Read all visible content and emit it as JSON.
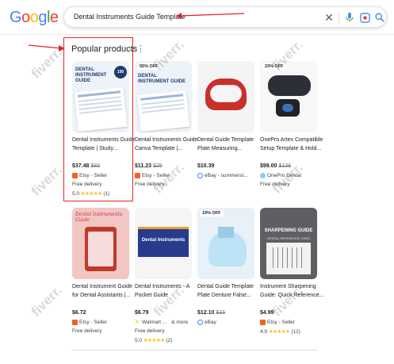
{
  "header": {
    "logo": "Google",
    "search_query": "Dental Instruments Guide Template"
  },
  "section": {
    "title": "Popular products"
  },
  "products": [
    {
      "badge": "",
      "thumb_title": "DENTAL INSTRUMENT GUIDE",
      "thumb_count": "190",
      "title": "Dental Instruments Guide Template | Study...",
      "price": "$37.48",
      "old_price": "$83",
      "seller": "Etsy - Seller",
      "delivery": "Free delivery",
      "rating": "5.0",
      "stars": "★★★★★",
      "reviews": "(1)",
      "seller_icon": "etsy-icon"
    },
    {
      "badge": "55% OFF",
      "thumb_title": "DENTAL INSTRUMENT GUIDE",
      "thumb_count": "",
      "title": "Dental Instruments Guide Canva Template |...",
      "price": "$11.23",
      "old_price": "$25",
      "seller": "Etsy - Seller",
      "delivery": "Free delivery",
      "rating": "",
      "stars": "",
      "reviews": "",
      "seller_icon": "etsy-icon"
    },
    {
      "badge": "",
      "thumb_title": "",
      "thumb_count": "",
      "title": "Dental Guide Template Plate Measuring...",
      "price": "$10.39",
      "old_price": "",
      "seller": "eBay - summerst...",
      "delivery": "",
      "rating": "",
      "stars": "",
      "reviews": "",
      "seller_icon": "ebay-icon"
    },
    {
      "badge": "23% OFF",
      "thumb_title": "",
      "thumb_count": "",
      "title": "OnePro Artex Compatible Setup Template & Hold...",
      "price": "$99.00",
      "old_price": "$129",
      "seller": "OnePro Dental",
      "delivery": "Free delivery",
      "rating": "",
      "stars": "",
      "reviews": "",
      "seller_icon": "onepro-icon"
    },
    {
      "badge": "",
      "thumb_title": "Dental Instruments Guide",
      "thumb_count": "",
      "title": "Dental Instrument Guide for Dental Assistants |...",
      "price": "$6.72",
      "old_price": "",
      "seller": "Etsy - Seller",
      "delivery": "Free delivery",
      "rating": "",
      "stars": "",
      "reviews": "",
      "seller_icon": "etsy-icon"
    },
    {
      "badge": "",
      "thumb_title": "Dental Instruments",
      "thumb_count": "",
      "title": "Dental Instruments - A Pocket Guide",
      "price": "$6.79",
      "old_price": "",
      "seller": "Walmart ...",
      "seller_more": "& more",
      "delivery": "Free delivery",
      "rating": "5.0",
      "stars": "★★★★★",
      "reviews": "(2)",
      "seller_icon": "walmart-icon"
    },
    {
      "badge": "19% OFF",
      "thumb_title": "",
      "thumb_count": "",
      "title": "Dental Guide Template Plate Denture False...",
      "price": "$12.10",
      "old_price": "$15",
      "seller": "eBay",
      "delivery": "",
      "rating": "",
      "stars": "",
      "reviews": "",
      "seller_icon": "ebay-icon"
    },
    {
      "badge": "",
      "thumb_title": "SHARPENING GUIDE",
      "thumb_subtitle": "DENTAL REFERENCE CARD",
      "thumb_count": "",
      "title": "Instrument Sharpening Guide: Quick Reference...",
      "price": "$4.99",
      "old_price": "",
      "seller": "Etsy - Seller",
      "delivery": "",
      "rating": "4.9",
      "stars": "★★★★★",
      "reviews": "(12)",
      "seller_icon": "etsy-icon"
    }
  ],
  "watermark": "fiverr.",
  "colors": {
    "annotation_red": "#e8232a",
    "star_yellow": "#fbbc04",
    "etsy_orange": "#f1641e"
  }
}
